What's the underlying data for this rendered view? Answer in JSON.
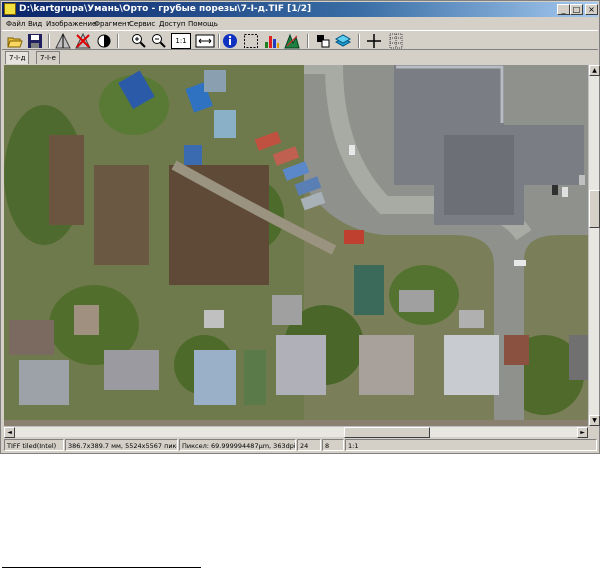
{
  "window": {
    "title": "D:\\kartgrupa\\Умань\\Орто - грубые порезы\\7-I-д.TIF [1/2]",
    "controls": [
      "_",
      "□",
      "×"
    ]
  },
  "menu": [
    "Файл",
    "Вид",
    "Изображение",
    "Фрагмент",
    "Сервис",
    "Доступ",
    "Помощь"
  ],
  "toolbar": {
    "buttons": [
      "open-icon",
      "save-icon",
      "flip-icon",
      "no-flip-icon",
      "contrast-icon",
      "zoom-in-icon",
      "zoom-out-icon",
      "actual-size-icon",
      "fit-window-icon",
      "info-icon",
      "select-icon",
      "histogram-icon",
      "levels-icon",
      "invert-icon",
      "layers-icon",
      "crosshair-icon",
      "grid-icon"
    ],
    "actual_size_label": "1:1"
  },
  "tabs": [
    "7-I-д",
    "7-I-е"
  ],
  "scroll": {
    "left": "◄",
    "right": "►",
    "up": "▲",
    "down": "▼"
  },
  "status": {
    "format": "TIFF tiled(Intel)",
    "size": "386.7x389.7 мм, 5524x5567 пикс",
    "pixel": "Пиксел: 69.999994487µm, 363dpi",
    "bits": "24",
    "channels": "8",
    "zoom": "1:1"
  },
  "colors": {
    "title_start": "#0a246a",
    "title_end": "#a6caf0",
    "face": "#d4d0c8"
  }
}
